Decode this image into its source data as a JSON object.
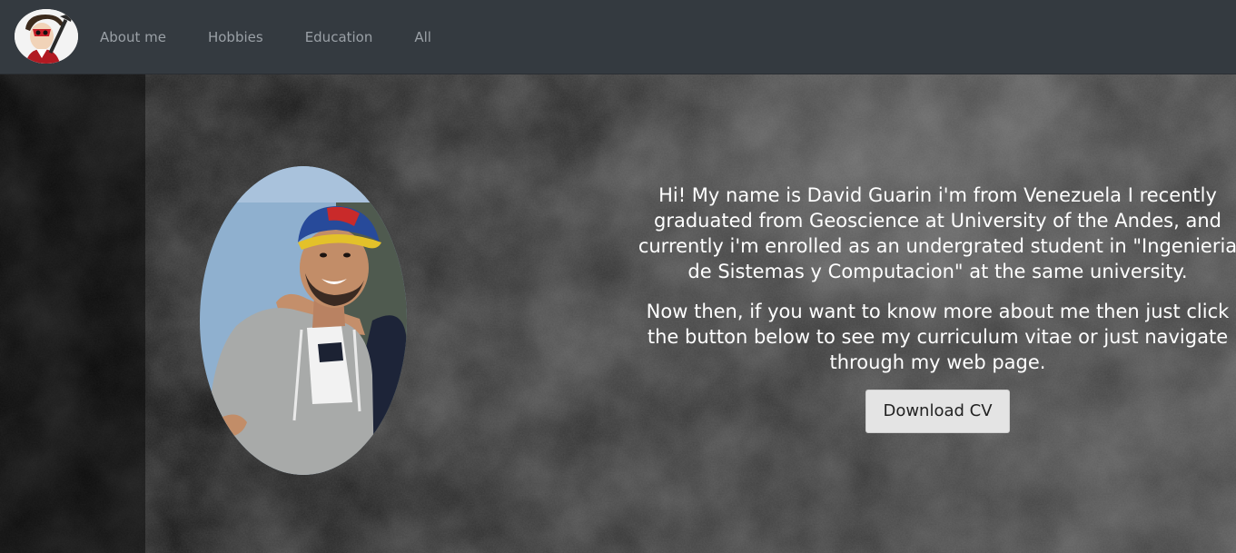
{
  "nav": {
    "logo": "avatar-logo",
    "links": [
      "About me",
      "Hobbies",
      "Education",
      "All"
    ]
  },
  "hero": {
    "intro_paragraph": "Hi! My name is David Guarin i'm from Venezuela I recently graduated from Geoscience at University of the Andes, and currently i'm enrolled as an undergrated student in \"Ingenieria de Sistemas y Computacion\" at the same university.",
    "navigate_paragraph": "Now then, if you want to know more about me then just click the button below to see my curriculum vitae or just navigate through my web page.",
    "download_button_label": "Download CV",
    "portrait": "profile-photo"
  },
  "colors": {
    "navbar_bg": "#343a40",
    "nav_link": "#9aa0a6",
    "button_bg": "#e4e4e4",
    "text": "#ffffff"
  }
}
